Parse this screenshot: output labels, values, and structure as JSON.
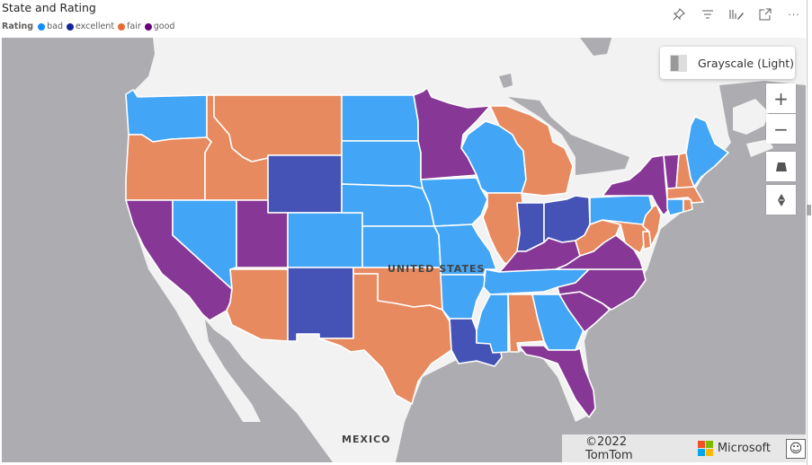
{
  "visual": {
    "title": "State and Rating",
    "toolbar": [
      "pin-icon",
      "filter-icon",
      "format-icon",
      "focus-mode-icon",
      "more-options-icon"
    ]
  },
  "legend": {
    "title": "Rating",
    "items": [
      {
        "label": "bad",
        "color": "#118DFF"
      },
      {
        "label": "excellent",
        "color": "#12239E"
      },
      {
        "label": "fair",
        "color": "#E66C37"
      },
      {
        "label": "good",
        "color": "#6B007B"
      }
    ]
  },
  "fill_colors": {
    "bad": "#42A5F5",
    "excellent": "#4453B5",
    "fair": "#E88A5F",
    "good": "#873795"
  },
  "map": {
    "style_label": "Grayscale (Light)",
    "country_labels": [
      "UNITED STATES",
      "MEXICO"
    ],
    "controls": {
      "zoom_in": "+",
      "zoom_out": "−"
    },
    "attribution": "©2022 TomTom",
    "brand": "Microsoft",
    "feedback_icon": "☺"
  },
  "chart_data": {
    "type": "choropleth",
    "title": "State and Rating",
    "legend_title": "Rating",
    "categories": [
      "bad",
      "excellent",
      "fair",
      "good"
    ],
    "regions": {
      "Washington": "bad",
      "Oregon": "fair",
      "California": "good",
      "Idaho": "fair",
      "Nevada": "bad",
      "Montana": "fair",
      "Wyoming": "excellent",
      "Utah": "good",
      "Arizona": "fair",
      "Colorado": "bad",
      "New Mexico": "excellent",
      "North Dakota": "bad",
      "South Dakota": "bad",
      "Nebraska": "bad",
      "Kansas": "bad",
      "Oklahoma": "fair",
      "Texas": "fair",
      "Minnesota": "good",
      "Iowa": "bad",
      "Missouri": "bad",
      "Arkansas": "bad",
      "Louisiana": "excellent",
      "Wisconsin": "bad",
      "Illinois": "fair",
      "Michigan": "fair",
      "Indiana": "excellent",
      "Ohio": "excellent",
      "Kentucky": "good",
      "Tennessee": "bad",
      "Mississippi": "bad",
      "Alabama": "fair",
      "Georgia": "bad",
      "Florida": "good",
      "South Carolina": "good",
      "North Carolina": "good",
      "Virginia": "good",
      "West Virginia": "fair",
      "Maryland": "fair",
      "Delaware": "fair",
      "New Jersey": "fair",
      "Pennsylvania": "bad",
      "New York": "good",
      "Vermont": "good",
      "New Hampshire": "fair",
      "Maine": "bad",
      "Massachusetts": "fair",
      "Connecticut": "bad",
      "Rhode Island": "fair"
    }
  }
}
